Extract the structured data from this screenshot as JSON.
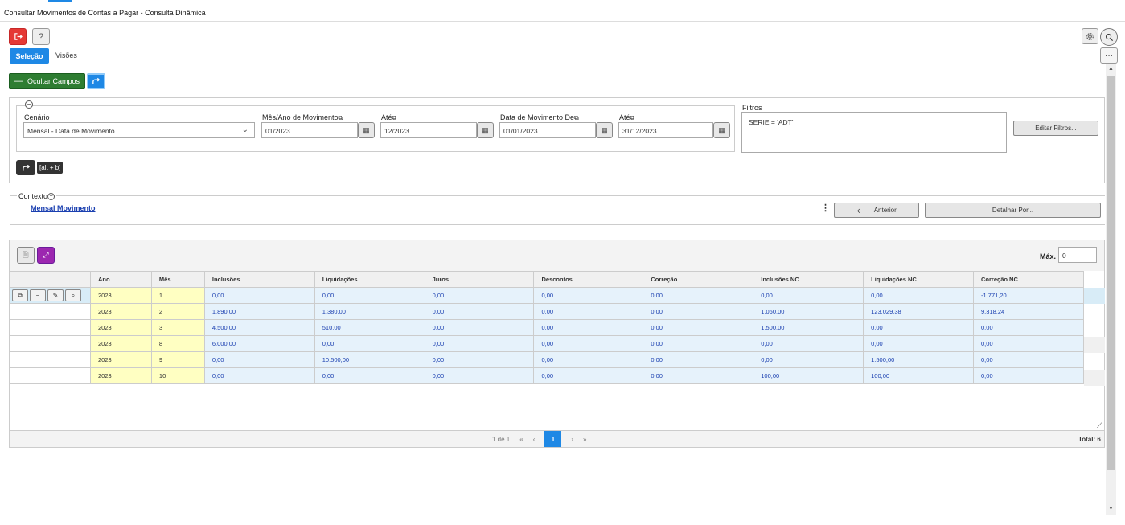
{
  "window": {
    "title": "Consultar Movimentos de Contas a Pagar - Consulta Dinâmica"
  },
  "toolbar": {
    "exit_icon": "exit-icon",
    "help_label": "?",
    "settings_icon": "gear-icon",
    "search_icon": "search-icon",
    "more_label": "···"
  },
  "tabs": [
    {
      "label": "Seleção",
      "active": true
    },
    {
      "label": "Visões",
      "active": false
    }
  ],
  "actions": {
    "hide_fields_label": "Ocultar Campos",
    "share_icon": "share-icon"
  },
  "filters_panel": {
    "scenario_label": "Cenário",
    "scenario_value": "Mensal - Data de Movimento",
    "month_year_from_label": "Mês/Ano de Movimento",
    "month_year_from_value": "01/2023",
    "month_year_to_label": "Até",
    "month_year_to_value": "12/2023",
    "date_from_label": "Data de Movimento De",
    "date_from_value": "01/01/2023",
    "date_to_label": "Até",
    "date_to_value": "31/12/2023",
    "filters_label": "Filtros",
    "filters_text": "SERIE = 'ADT'",
    "edit_filters_label": "Editar Filtros...",
    "shortcut_tooltip": "[alt + b]"
  },
  "context": {
    "label": "Contexto",
    "link": "Mensal Movimento",
    "previous_label": "Anterior",
    "drill_label": "Detalhar Por..."
  },
  "grid": {
    "max_label": "Máx.",
    "max_value": "0",
    "columns": [
      "Ano",
      "Mês",
      "Inclusões",
      "Liquidações",
      "Juros",
      "Descontos",
      "Correção",
      "Inclusões NC",
      "Liquidações NC",
      "Correção NC"
    ],
    "rows": [
      [
        "2023",
        "1",
        "0,00",
        "0,00",
        "0,00",
        "0,00",
        "0,00",
        "0,00",
        "0,00",
        "-1.771,20"
      ],
      [
        "2023",
        "2",
        "1.890,00",
        "1.380,00",
        "0,00",
        "0,00",
        "0,00",
        "1.060,00",
        "123.029,38",
        "9.318,24"
      ],
      [
        "2023",
        "3",
        "4.500,00",
        "510,00",
        "0,00",
        "0,00",
        "0,00",
        "1.500,00",
        "0,00",
        "0,00"
      ],
      [
        "2023",
        "8",
        "6.000,00",
        "0,00",
        "0,00",
        "0,00",
        "0,00",
        "0,00",
        "0,00",
        "0,00"
      ],
      [
        "2023",
        "9",
        "0,00",
        "10.500,00",
        "0,00",
        "0,00",
        "0,00",
        "0,00",
        "1.500,00",
        "0,00"
      ],
      [
        "2023",
        "10",
        "0,00",
        "0,00",
        "0,00",
        "0,00",
        "0,00",
        "100,00",
        "100,00",
        "0,00"
      ]
    ],
    "pager": {
      "page_info": "1 de 1",
      "first": "«",
      "prev": "‹",
      "current": "1",
      "next": "›",
      "last": "»"
    },
    "total_label": "Total: 6"
  }
}
